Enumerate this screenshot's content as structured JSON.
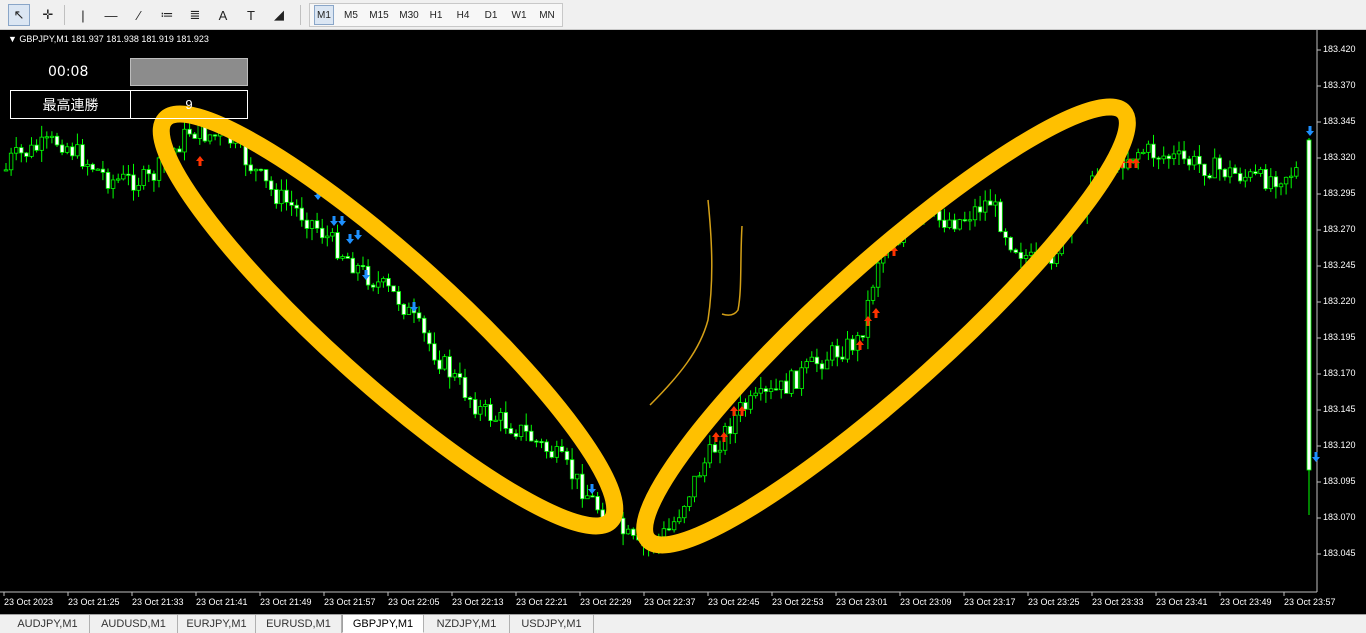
{
  "toolbar": {
    "tools": [
      {
        "name": "cursor-icon",
        "glyph": "↖"
      },
      {
        "name": "crosshair-icon",
        "glyph": "✛"
      },
      {
        "name": "vertical-line-icon",
        "glyph": "|"
      },
      {
        "name": "horizontal-line-icon",
        "glyph": "—"
      },
      {
        "name": "trendline-icon",
        "glyph": "∕"
      },
      {
        "name": "channel-icon",
        "glyph": "≔"
      },
      {
        "name": "fibonacci-icon",
        "glyph": "≣"
      },
      {
        "name": "text-icon",
        "glyph": "A"
      },
      {
        "name": "text-label-icon",
        "glyph": "T"
      },
      {
        "name": "shapes-icon",
        "glyph": "◢"
      }
    ],
    "timeframes": [
      "M1",
      "M5",
      "M15",
      "M30",
      "H1",
      "H4",
      "D1",
      "W1",
      "MN"
    ],
    "active_timeframe": "M1"
  },
  "chart": {
    "symbol_line": "GBPJPY,M1  181.937 181.938 181.919 181.923",
    "timer": "00:08",
    "stats_label": "最高連勝",
    "stats_value": "9",
    "price_labels": [
      "183.420",
      "183.370",
      "183.345",
      "183.320",
      "183.295",
      "183.270",
      "183.245",
      "183.220",
      "183.195",
      "183.170",
      "183.145",
      "183.120",
      "183.095",
      "183.070",
      "183.045"
    ],
    "time_labels": [
      "23 Oct 2023",
      "23 Oct 21:25",
      "23 Oct 21:33",
      "23 Oct 21:41",
      "23 Oct 21:49",
      "23 Oct 21:57",
      "23 Oct 22:05",
      "23 Oct 22:13",
      "23 Oct 22:21",
      "23 Oct 22:29",
      "23 Oct 22:37",
      "23 Oct 22:45",
      "23 Oct 22:53",
      "23 Oct 23:01",
      "23 Oct 23:09",
      "23 Oct 23:17",
      "23 Oct 23:25",
      "23 Oct 23:33",
      "23 Oct 23:41",
      "23 Oct 23:49",
      "23 Oct 23:57"
    ],
    "colors": {
      "background": "#000000",
      "candle": "#00ff00",
      "candle_fill_bull": "#000000",
      "candle_fill_bear": "#ffffff",
      "sell_arrow": "#1e90ff",
      "buy_arrow": "#ff3300",
      "highlight": "#ffc000"
    }
  },
  "tabs": {
    "items": [
      "AUDJPY,M1",
      "AUDUSD,M1",
      "EURJPY,M1",
      "EURUSD,M1",
      "GBPJPY,M1",
      "NZDJPY,M1",
      "USDJPY,M1"
    ],
    "active": "GBPJPY,M1"
  }
}
